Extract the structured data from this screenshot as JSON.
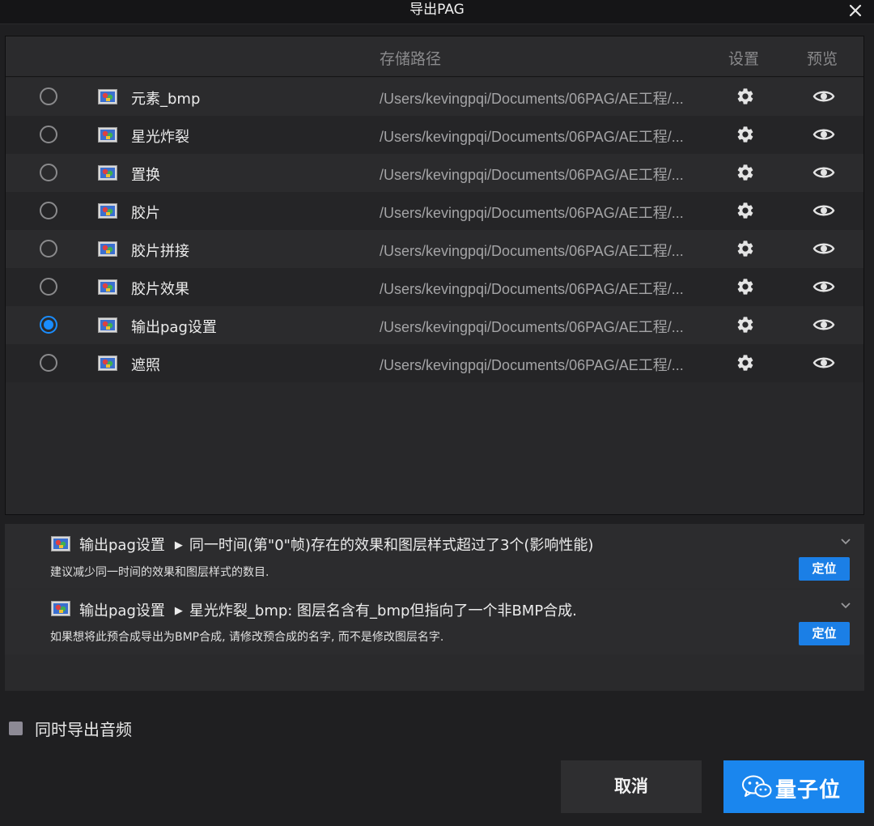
{
  "window": {
    "title": "导出PAG"
  },
  "table": {
    "headers": {
      "path": "存储路径",
      "settings": "设置",
      "preview": "预览"
    },
    "rows": [
      {
        "name": "元素_bmp",
        "path": "/Users/kevingpqi/Documents/06PAG/AE工程/...",
        "selected": false
      },
      {
        "name": "星光炸裂",
        "path": "/Users/kevingpqi/Documents/06PAG/AE工程/...",
        "selected": false
      },
      {
        "name": "置换",
        "path": "/Users/kevingpqi/Documents/06PAG/AE工程/...",
        "selected": false
      },
      {
        "name": "胶片",
        "path": "/Users/kevingpqi/Documents/06PAG/AE工程/...",
        "selected": false
      },
      {
        "name": "胶片拼接",
        "path": "/Users/kevingpqi/Documents/06PAG/AE工程/...",
        "selected": false
      },
      {
        "name": "胶片效果",
        "path": "/Users/kevingpqi/Documents/06PAG/AE工程/...",
        "selected": false
      },
      {
        "name": "输出pag设置",
        "path": "/Users/kevingpqi/Documents/06PAG/AE工程/...",
        "selected": true
      },
      {
        "name": "遮照",
        "path": "/Users/kevingpqi/Documents/06PAG/AE工程/...",
        "selected": false
      }
    ]
  },
  "messages": [
    {
      "comp": "输出pag设置",
      "title": "同一时间(第\"0\"帧)存在的效果和图层样式超过了3个(影响性能)",
      "detail": "建议减少同一时间的效果和图层样式的数目.",
      "button": "定位"
    },
    {
      "comp": "输出pag设置",
      "title": "星光炸裂_bmp: 图层名含有_bmp但指向了一个非BMP合成.",
      "detail": "如果想将此预合成导出为BMP合成, 请修改预合成的名字, 而不是修改图层名字.",
      "button": "定位"
    }
  ],
  "audio": {
    "label": "同时导出音频",
    "checked": false
  },
  "buttons": {
    "cancel": "取消"
  },
  "watermark": {
    "text": "量子位"
  },
  "colors": {
    "accent": "#1a86ee",
    "background": "#1f1f21",
    "panel": "#28282a"
  },
  "icons": {
    "row_comp": "composition-icon",
    "settings": "gear-icon",
    "preview": "eye-icon",
    "close": "close-icon",
    "expand": "chevron-down-icon"
  }
}
